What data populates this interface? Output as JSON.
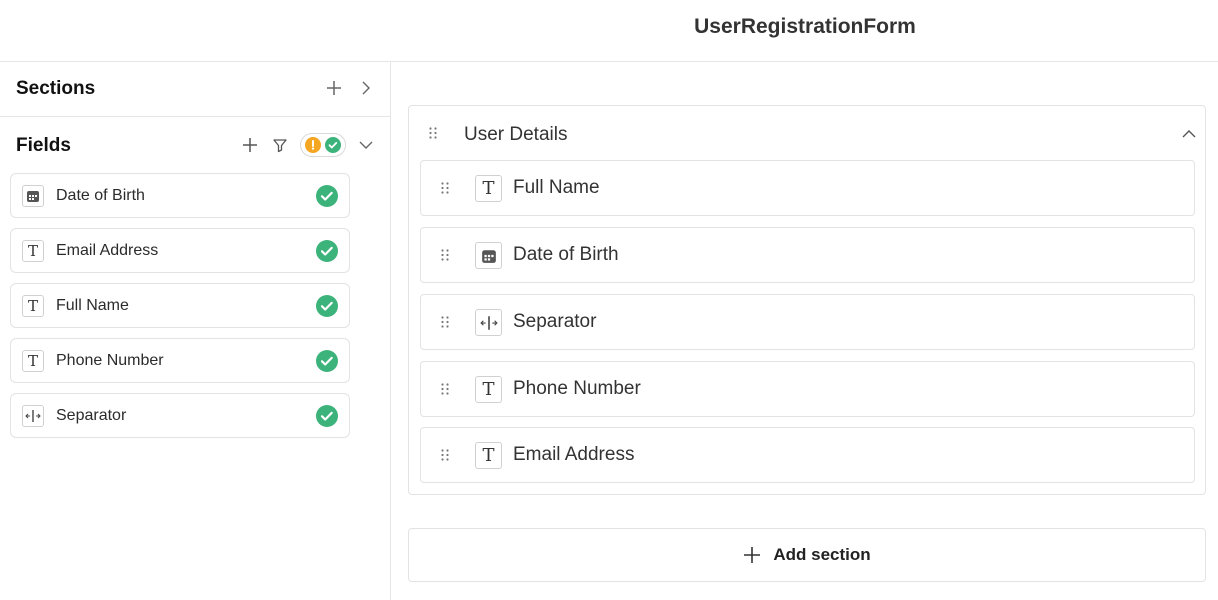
{
  "header": {
    "title": "UserRegistrationForm"
  },
  "sidebar": {
    "sections_label": "Sections",
    "fields_label": "Fields",
    "fields": [
      {
        "label": "Date of Birth",
        "icon": "calendar-icon",
        "status": "valid"
      },
      {
        "label": "Email Address",
        "icon": "text-type-icon",
        "status": "valid"
      },
      {
        "label": "Full Name",
        "icon": "text-type-icon",
        "status": "valid"
      },
      {
        "label": "Phone Number",
        "icon": "text-type-icon",
        "status": "valid"
      },
      {
        "label": "Separator",
        "icon": "separator-icon",
        "status": "valid"
      }
    ]
  },
  "main": {
    "section": {
      "title": "User Details",
      "fields": [
        {
          "label": "Full Name",
          "icon": "text-type-icon"
        },
        {
          "label": "Date of Birth",
          "icon": "calendar-icon"
        },
        {
          "label": "Separator",
          "icon": "separator-icon"
        },
        {
          "label": "Phone Number",
          "icon": "text-type-icon"
        },
        {
          "label": "Email Address",
          "icon": "text-type-icon"
        }
      ]
    },
    "add_section_label": "Add section"
  },
  "colors": {
    "success": "#3cb37a",
    "warning": "#f5a623",
    "border": "#e3e3e3",
    "icon": "#666666"
  }
}
